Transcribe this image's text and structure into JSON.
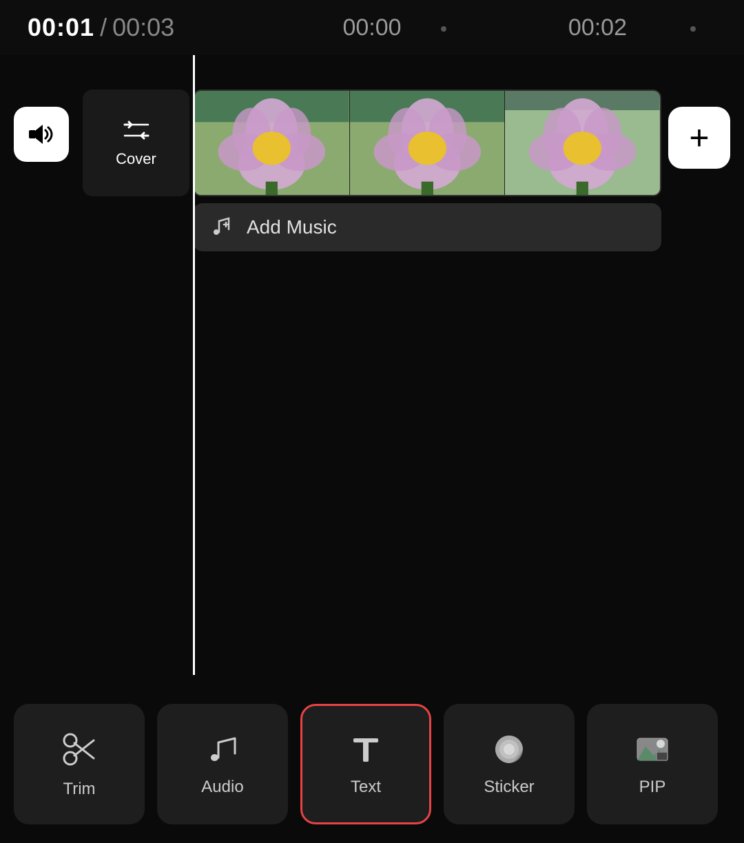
{
  "header": {
    "time_current": "00:01",
    "time_separator": "/",
    "time_total": "00:03",
    "time_mid": "00:00",
    "time_end": "00:02"
  },
  "cover": {
    "label": "Cover"
  },
  "add_music": {
    "label": "Add Music"
  },
  "toolbar": {
    "tools": [
      {
        "id": "trim",
        "label": "Trim",
        "icon": "scissors"
      },
      {
        "id": "audio",
        "label": "Audio",
        "icon": "music-note"
      },
      {
        "id": "text",
        "label": "Text",
        "icon": "text-t",
        "active": true
      },
      {
        "id": "sticker",
        "label": "Sticker",
        "icon": "sticker"
      },
      {
        "id": "pip",
        "label": "PIP",
        "icon": "pip"
      }
    ]
  },
  "colors": {
    "accent_red": "#e84343",
    "bg_dark": "#0a0a0a",
    "tool_bg": "#1e1e1e",
    "text_primary": "#ffffff",
    "text_secondary": "#999999"
  }
}
